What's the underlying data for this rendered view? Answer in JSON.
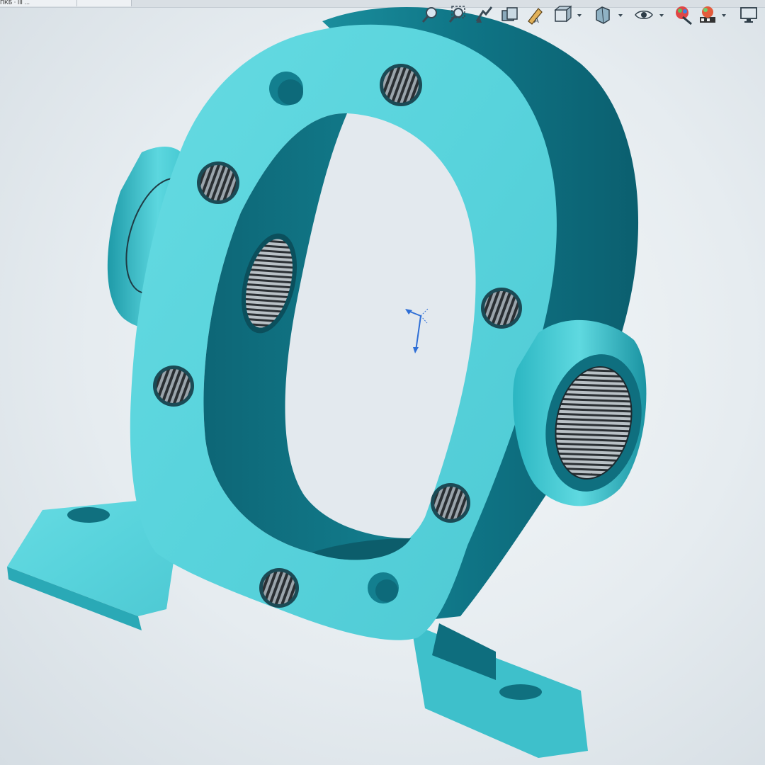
{
  "window": {
    "tab_left_label": "ПКБ · III ...",
    "tab_right_label": ""
  },
  "toolbar": {
    "icons": [
      "zoom-to-fit-icon",
      "zoom-to-area-icon",
      "previous-view-icon",
      "section-view-icon",
      "dynamic-annotation-icon",
      "view-orientation-icon",
      "display-style-icon",
      "hide-show-items-icon",
      "edit-appearance-icon",
      "apply-scene-icon",
      "view-settings-icon"
    ]
  },
  "colors": {
    "part_light": "#5ad6de",
    "part_dark": "#0f6f7f",
    "background": "#eaeff3",
    "triad_blue": "#2f6fd6"
  }
}
